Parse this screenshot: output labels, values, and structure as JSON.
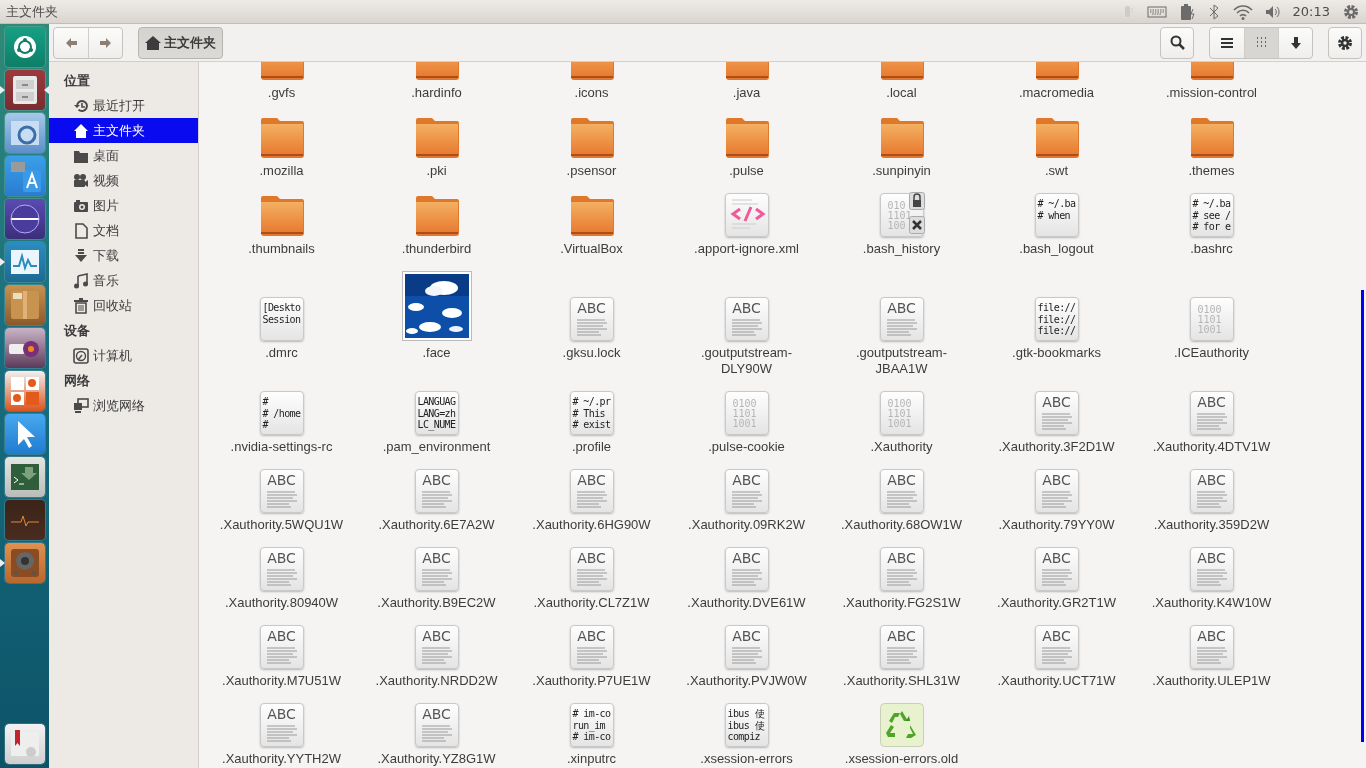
{
  "top_panel": {
    "title": "主文件夹",
    "time": "20:13"
  },
  "dock": {
    "items": [
      {
        "kind": "dash",
        "running": false,
        "focused": false
      },
      {
        "kind": "files",
        "running": true,
        "focused": true
      },
      {
        "kind": "chromium",
        "running": false,
        "focused": false
      },
      {
        "kind": "translate",
        "running": false,
        "focused": false
      },
      {
        "kind": "sphere",
        "running": false,
        "focused": false
      },
      {
        "kind": "sysmon",
        "running": true,
        "focused": false
      },
      {
        "kind": "archive",
        "running": false,
        "focused": false
      },
      {
        "kind": "usb",
        "running": false,
        "focused": false
      },
      {
        "kind": "tools",
        "running": false,
        "focused": false
      },
      {
        "kind": "pointer",
        "running": false,
        "focused": false
      },
      {
        "kind": "terminal",
        "running": false,
        "focused": false
      },
      {
        "kind": "pulse",
        "running": false,
        "focused": false
      },
      {
        "kind": "speaker",
        "running": true,
        "focused": false
      }
    ],
    "bottom_items": [
      {
        "kind": "mail",
        "running": false,
        "focused": false
      }
    ]
  },
  "toolbar": {
    "path": [
      {
        "label": "主文件夹",
        "selected": true
      }
    ],
    "view_modes": [
      {
        "kind": "list",
        "selected": false
      },
      {
        "kind": "grid",
        "selected": true
      }
    ]
  },
  "sidebar": {
    "sections": [
      {
        "title": "位置",
        "items": [
          {
            "label": "最近打开",
            "kind": "recent",
            "selected": false
          },
          {
            "label": "主文件夹",
            "kind": "home",
            "selected": true
          },
          {
            "label": "桌面",
            "kind": "folder",
            "selected": false
          },
          {
            "label": "视频",
            "kind": "video",
            "selected": false
          },
          {
            "label": "图片",
            "kind": "camera",
            "selected": false
          },
          {
            "label": "文档",
            "kind": "document",
            "selected": false
          },
          {
            "label": "下载",
            "kind": "download",
            "selected": false
          },
          {
            "label": "音乐",
            "kind": "music",
            "selected": false
          },
          {
            "label": "回收站",
            "kind": "trash",
            "selected": false
          }
        ]
      },
      {
        "title": "设备",
        "items": [
          {
            "label": "计算机",
            "kind": "disk",
            "selected": false
          }
        ]
      },
      {
        "title": "网络",
        "items": [
          {
            "label": "浏览网络",
            "kind": "network",
            "selected": false
          }
        ]
      }
    ]
  },
  "files": [
    {
      "name": ".gvfs",
      "kind": "folder"
    },
    {
      "name": ".hardinfo",
      "kind": "folder"
    },
    {
      "name": ".icons",
      "kind": "folder"
    },
    {
      "name": ".java",
      "kind": "folder"
    },
    {
      "name": ".local",
      "kind": "folder"
    },
    {
      "name": ".macromedia",
      "kind": "folder"
    },
    {
      "name": ".mission-control",
      "kind": "folder"
    },
    {
      "name": ".mozilla",
      "kind": "folder"
    },
    {
      "name": ".pki",
      "kind": "folder"
    },
    {
      "name": ".psensor",
      "kind": "folder"
    },
    {
      "name": ".pulse",
      "kind": "folder"
    },
    {
      "name": ".sunpinyin",
      "kind": "folder"
    },
    {
      "name": ".swt",
      "kind": "folder"
    },
    {
      "name": ".themes",
      "kind": "folder"
    },
    {
      "name": ".thumbnails",
      "kind": "folder"
    },
    {
      "name": ".thunderbird",
      "kind": "folder"
    },
    {
      "name": ".VirtualBox",
      "kind": "folder"
    },
    {
      "name": ".apport-ignore.xml",
      "kind": "xml"
    },
    {
      "name": ".bash_history",
      "kind": "locked-binary",
      "preview": [
        "010",
        "1101",
        "100"
      ]
    },
    {
      "name": ".bash_logout",
      "kind": "script",
      "preview": [
        "# ~/.ba",
        "# when"
      ]
    },
    {
      "name": ".bashrc",
      "kind": "script",
      "preview": [
        "# ~/.ba",
        "# see /",
        "# for e"
      ]
    },
    {
      "name": ".dmrc",
      "kind": "script",
      "preview": [
        "[Deskto",
        "Session"
      ]
    },
    {
      "name": ".face",
      "kind": "picture"
    },
    {
      "name": ".gksu.lock",
      "kind": "text",
      "preview": [
        "ABC"
      ]
    },
    {
      "name": ".goutputstream-DLY90W",
      "kind": "text",
      "preview": [
        "ABC"
      ]
    },
    {
      "name": ".goutputstream-JBAA1W",
      "kind": "text",
      "preview": [
        "ABC"
      ]
    },
    {
      "name": ".gtk-bookmarks",
      "kind": "script",
      "preview": [
        "file://",
        "file://",
        "file://"
      ]
    },
    {
      "name": ".ICEauthority",
      "kind": "binary",
      "preview": [
        "0100",
        "1101",
        "1001"
      ]
    },
    {
      "name": ".nvidia-settings-rc",
      "kind": "script",
      "preview": [
        "#",
        "# /home",
        "#"
      ]
    },
    {
      "name": ".pam_environment",
      "kind": "script",
      "preview": [
        "LANGUAG",
        "LANG=zh",
        "LC_NUME"
      ]
    },
    {
      "name": ".profile",
      "kind": "script",
      "preview": [
        "# ~/.pr",
        "# This",
        "# exist"
      ]
    },
    {
      "name": ".pulse-cookie",
      "kind": "binary",
      "preview": [
        "0100",
        "1101",
        "1001"
      ]
    },
    {
      "name": ".Xauthority",
      "kind": "binary",
      "preview": [
        "0100",
        "1101",
        "1001"
      ]
    },
    {
      "name": ".Xauthority.3F2D1W",
      "kind": "text",
      "preview": [
        "ABC"
      ]
    },
    {
      "name": ".Xauthority.4DTV1W",
      "kind": "text",
      "preview": [
        "ABC"
      ]
    },
    {
      "name": ".Xauthority.5WQU1W",
      "kind": "text",
      "preview": [
        "ABC"
      ]
    },
    {
      "name": ".Xauthority.6E7A2W",
      "kind": "text",
      "preview": [
        "ABC"
      ]
    },
    {
      "name": ".Xauthority.6HG90W",
      "kind": "text",
      "preview": [
        "ABC"
      ]
    },
    {
      "name": ".Xauthority.09RK2W",
      "kind": "text",
      "preview": [
        "ABC"
      ]
    },
    {
      "name": ".Xauthority.68OW1W",
      "kind": "text",
      "preview": [
        "ABC"
      ]
    },
    {
      "name": ".Xauthority.79YY0W",
      "kind": "text",
      "preview": [
        "ABC"
      ]
    },
    {
      "name": ".Xauthority.359D2W",
      "kind": "text",
      "preview": [
        "ABC"
      ]
    },
    {
      "name": ".Xauthority.80940W",
      "kind": "text",
      "preview": [
        "ABC"
      ]
    },
    {
      "name": ".Xauthority.B9EC2W",
      "kind": "text",
      "preview": [
        "ABC"
      ]
    },
    {
      "name": ".Xauthority.CL7Z1W",
      "kind": "text",
      "preview": [
        "ABC"
      ]
    },
    {
      "name": ".Xauthority.DVE61W",
      "kind": "text",
      "preview": [
        "ABC"
      ]
    },
    {
      "name": ".Xauthority.FG2S1W",
      "kind": "text",
      "preview": [
        "ABC"
      ]
    },
    {
      "name": ".Xauthority.GR2T1W",
      "kind": "text",
      "preview": [
        "ABC"
      ]
    },
    {
      "name": ".Xauthority.K4W10W",
      "kind": "text",
      "preview": [
        "ABC"
      ]
    },
    {
      "name": ".Xauthority.M7U51W",
      "kind": "text",
      "preview": [
        "ABC"
      ]
    },
    {
      "name": ".Xauthority.NRDD2W",
      "kind": "text",
      "preview": [
        "ABC"
      ]
    },
    {
      "name": ".Xauthority.P7UE1W",
      "kind": "text",
      "preview": [
        "ABC"
      ]
    },
    {
      "name": ".Xauthority.PVJW0W",
      "kind": "text",
      "preview": [
        "ABC"
      ]
    },
    {
      "name": ".Xauthority.SHL31W",
      "kind": "text",
      "preview": [
        "ABC"
      ]
    },
    {
      "name": ".Xauthority.UCT71W",
      "kind": "text",
      "preview": [
        "ABC"
      ]
    },
    {
      "name": ".Xauthority.ULEP1W",
      "kind": "text",
      "preview": [
        "ABC"
      ]
    },
    {
      "name": ".Xauthority.YYTH2W",
      "kind": "text",
      "preview": [
        "ABC"
      ]
    },
    {
      "name": ".Xauthority.YZ8G1W",
      "kind": "text",
      "preview": [
        "ABC"
      ]
    },
    {
      "name": ".xinputrc",
      "kind": "script",
      "preview": [
        "# im-co",
        "run_im",
        "# im-co"
      ]
    },
    {
      "name": ".xsession-errors",
      "kind": "script",
      "preview": [
        "ibus 使",
        "ibus 使",
        "compiz"
      ]
    },
    {
      "name": ".xsession-errors.old",
      "kind": "recycle"
    }
  ]
}
